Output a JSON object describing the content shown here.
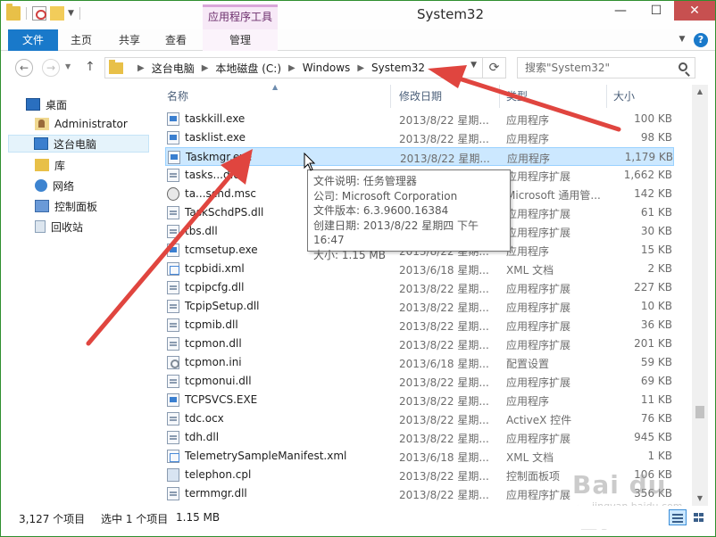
{
  "titlebar": {
    "context_tab": "应用程序工具",
    "title": "System32",
    "minimize": "—",
    "maximize": "☐",
    "close": "✕"
  },
  "ribbon": {
    "tab_file": "文件",
    "tab_home": "主页",
    "tab_share": "共享",
    "tab_view": "查看",
    "tab_manage": "管理",
    "help": "?"
  },
  "address": {
    "crumbs": [
      "这台电脑",
      "本地磁盘 (C:)",
      "Windows",
      "System32"
    ],
    "search_placeholder": "搜索\"System32\""
  },
  "sidebar": {
    "items": [
      {
        "label": "桌面",
        "icon": "desktop-icon"
      },
      {
        "label": "Administrator",
        "icon": "user-folder-icon"
      },
      {
        "label": "这台电脑",
        "icon": "computer-icon"
      },
      {
        "label": "库",
        "icon": "library-icon"
      },
      {
        "label": "网络",
        "icon": "network-icon"
      },
      {
        "label": "控制面板",
        "icon": "control-panel-icon"
      },
      {
        "label": "回收站",
        "icon": "recycle-bin-icon"
      }
    ]
  },
  "columns": {
    "name": "名称",
    "date": "修改日期",
    "type": "类型",
    "size": "大小"
  },
  "files": [
    {
      "name": "taskkill.exe",
      "date": "2013/8/22 星期...",
      "type": "应用程序",
      "size": "100 KB",
      "icon": "exe"
    },
    {
      "name": "tasklist.exe",
      "date": "2013/8/22 星期...",
      "type": "应用程序",
      "size": "98 KB",
      "icon": "exe"
    },
    {
      "name": "Taskmgr.exe",
      "date": "2013/8/22 星期...",
      "type": "应用程序",
      "size": "1,179 KB",
      "icon": "exe"
    },
    {
      "name": "tasks...d.dll",
      "date": "2013/8/22 星期...",
      "type": "应用程序扩展",
      "size": "1,662 KB",
      "icon": "dll"
    },
    {
      "name": "ta...schd.msc",
      "date": "2013/8/22 星期...",
      "type": "Microsoft 通用管...",
      "size": "142 KB",
      "icon": "msc"
    },
    {
      "name": "TaskSchdPS.dll",
      "date": "2013/8/22 星期...",
      "type": "应用程序扩展",
      "size": "61 KB",
      "icon": "dll"
    },
    {
      "name": "tbs.dll",
      "date": "2013/8/22 星期...",
      "type": "应用程序扩展",
      "size": "30 KB",
      "icon": "dll"
    },
    {
      "name": "tcmsetup.exe",
      "date": "2013/8/22 星期...",
      "type": "应用程序",
      "size": "15 KB",
      "icon": "exe"
    },
    {
      "name": "tcpbidi.xml",
      "date": "2013/6/18 星期...",
      "type": "XML 文档",
      "size": "2 KB",
      "icon": "xml"
    },
    {
      "name": "tcpipcfg.dll",
      "date": "2013/8/22 星期...",
      "type": "应用程序扩展",
      "size": "227 KB",
      "icon": "dll"
    },
    {
      "name": "TcpipSetup.dll",
      "date": "2013/8/22 星期...",
      "type": "应用程序扩展",
      "size": "10 KB",
      "icon": "dll"
    },
    {
      "name": "tcpmib.dll",
      "date": "2013/8/22 星期...",
      "type": "应用程序扩展",
      "size": "36 KB",
      "icon": "dll"
    },
    {
      "name": "tcpmon.dll",
      "date": "2013/8/22 星期...",
      "type": "应用程序扩展",
      "size": "201 KB",
      "icon": "dll"
    },
    {
      "name": "tcpmon.ini",
      "date": "2013/6/18 星期...",
      "type": "配置设置",
      "size": "59 KB",
      "icon": "ini"
    },
    {
      "name": "tcpmonui.dll",
      "date": "2013/8/22 星期...",
      "type": "应用程序扩展",
      "size": "69 KB",
      "icon": "dll"
    },
    {
      "name": "TCPSVCS.EXE",
      "date": "2013/8/22 星期...",
      "type": "应用程序",
      "size": "11 KB",
      "icon": "exe"
    },
    {
      "name": "tdc.ocx",
      "date": "2013/8/22 星期...",
      "type": "ActiveX 控件",
      "size": "76 KB",
      "icon": "dll"
    },
    {
      "name": "tdh.dll",
      "date": "2013/8/22 星期...",
      "type": "应用程序扩展",
      "size": "945 KB",
      "icon": "dll"
    },
    {
      "name": "TelemetrySampleManifest.xml",
      "date": "2013/6/18 星期...",
      "type": "XML 文档",
      "size": "1 KB",
      "icon": "xml"
    },
    {
      "name": "telephon.cpl",
      "date": "2013/8/22 星期...",
      "type": "控制面板项",
      "size": "106 KB",
      "icon": "cpl"
    },
    {
      "name": "termmgr.dll",
      "date": "2013/8/22 星期...",
      "type": "应用程序扩展",
      "size": "356 KB",
      "icon": "dll"
    }
  ],
  "tooltip": {
    "lines": [
      "文件说明: 任务管理器",
      "公司: Microsoft Corporation",
      "文件版本: 6.3.9600.16384",
      "创建日期: 2013/8/22 星期四 下午 16:47",
      "大小: 1.15 MB"
    ]
  },
  "status": {
    "count": "3,127 个项目",
    "selected": "选中 1 个项目",
    "size": "1.15 MB"
  },
  "watermark": {
    "text": "Bai du 经验",
    "sub": "jingyan.baidu.com"
  },
  "colors": {
    "accent": "#1979ca",
    "selection": "#cce8ff",
    "context_tab": "#d9a6d9",
    "annotation_arrow": "#e0453f"
  }
}
